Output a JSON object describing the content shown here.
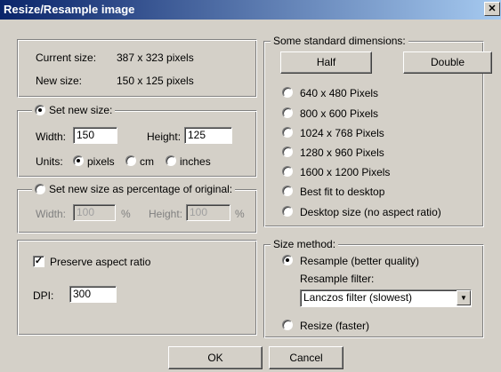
{
  "window": {
    "title": "Resize/Resample image",
    "close_glyph": "✕"
  },
  "info": {
    "current_label": "Current size:",
    "current_value": "387  x  323  pixels",
    "new_label": "New size:",
    "new_value": "150  x  125  pixels"
  },
  "set_new_size": {
    "legend": "Set new size:",
    "selected": true,
    "width_label": "Width:",
    "width_value": "150",
    "height_label": "Height:",
    "height_value": "125",
    "units_label": "Units:",
    "units": [
      {
        "label": "pixels",
        "selected": true
      },
      {
        "label": "cm",
        "selected": false
      },
      {
        "label": "inches",
        "selected": false
      }
    ]
  },
  "percentage": {
    "legend": "Set new size as percentage of original:",
    "selected": false,
    "width_label": "Width:",
    "width_value": "100",
    "width_unit": "%",
    "height_label": "Height:",
    "height_value": "100",
    "height_unit": "%"
  },
  "options": {
    "preserve_label": "Preserve aspect ratio",
    "preserve_checked": true,
    "check_glyph": "✓",
    "dpi_label": "DPI:",
    "dpi_value": "300"
  },
  "standard": {
    "legend": "Some standard dimensions:",
    "half_label": "Half",
    "double_label": "Double",
    "items": [
      {
        "label": "640 x 480 Pixels",
        "selected": false
      },
      {
        "label": "800 x 600 Pixels",
        "selected": false
      },
      {
        "label": "1024 x 768 Pixels",
        "selected": false
      },
      {
        "label": "1280 x 960 Pixels",
        "selected": false
      },
      {
        "label": "1600 x 1200 Pixels",
        "selected": false
      },
      {
        "label": "Best fit to desktop",
        "selected": false
      },
      {
        "label": "Desktop size (no aspect ratio)",
        "selected": false
      }
    ]
  },
  "method": {
    "legend": "Size method:",
    "resample_label": "Resample (better quality)",
    "resample_selected": true,
    "filter_label": "Resample filter:",
    "filter_value": "Lanczos filter (slowest)",
    "dropdown_glyph": "▼",
    "resize_label": "Resize (faster)",
    "resize_selected": false
  },
  "footer": {
    "ok_label": "OK",
    "cancel_label": "Cancel"
  }
}
